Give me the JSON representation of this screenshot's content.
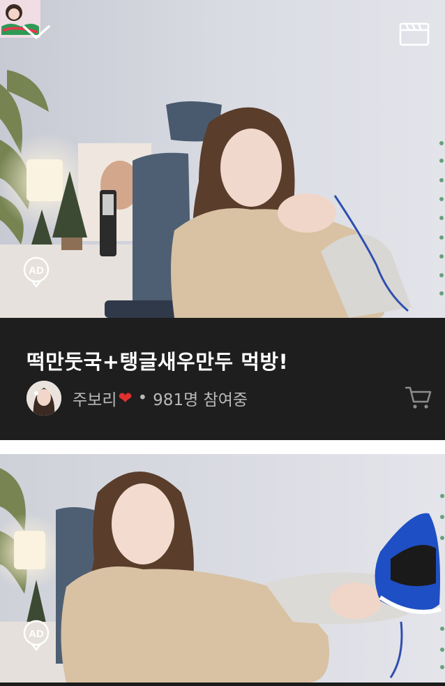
{
  "cards": [
    {
      "title": "떡만둣국+탱글새우만두 먹방!",
      "streamer": "주보리",
      "separator": "•",
      "viewers": "981명 참여중",
      "badge": "AD"
    },
    {
      "badge": "AD"
    }
  ],
  "icons": {
    "collapse": "chevron-down-icon",
    "clip": "clapperboard-icon",
    "cart": "cart-icon",
    "heart": "heart-icon"
  },
  "colors": {
    "card_background": "#1e1e1e",
    "title_text": "#ffffff",
    "meta_text": "#b9b9b9",
    "heart": "#e0302f",
    "sneaker_blue": "#1f4fc4"
  }
}
